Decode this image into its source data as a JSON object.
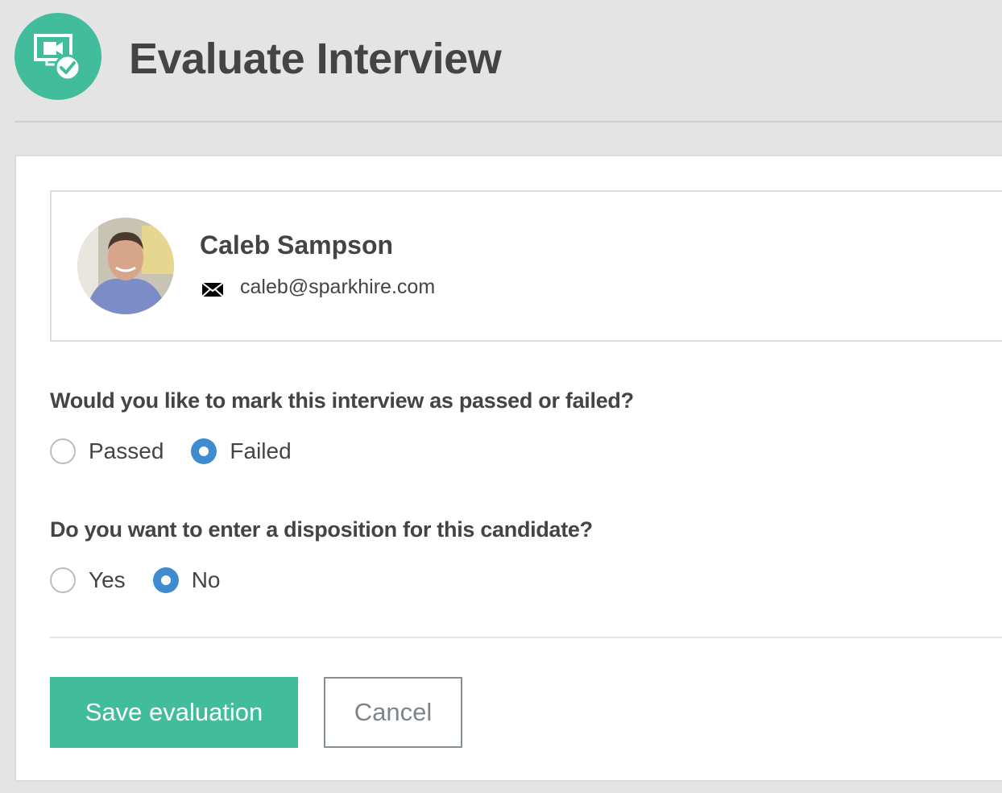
{
  "header": {
    "title": "Evaluate Interview",
    "icon": "video-monitor-check-icon",
    "accent_color": "#41bd9b"
  },
  "candidate": {
    "name": "Caleb Sampson",
    "email": "caleb@sparkhire.com",
    "email_icon": "envelope-icon",
    "avatar": "candidate-photo"
  },
  "questions": [
    {
      "text": "Would you like to mark this interview as passed or failed?",
      "options": [
        {
          "label": "Passed",
          "checked": false
        },
        {
          "label": "Failed",
          "checked": true
        }
      ]
    },
    {
      "text": "Do you want to enter a disposition for this candidate?",
      "options": [
        {
          "label": "Yes",
          "checked": false
        },
        {
          "label": "No",
          "checked": true
        }
      ]
    }
  ],
  "actions": {
    "save_label": "Save evaluation",
    "cancel_label": "Cancel"
  },
  "colors": {
    "primary": "#41bd9b",
    "radio_selected": "#3f8bd0",
    "text": "#444444"
  }
}
